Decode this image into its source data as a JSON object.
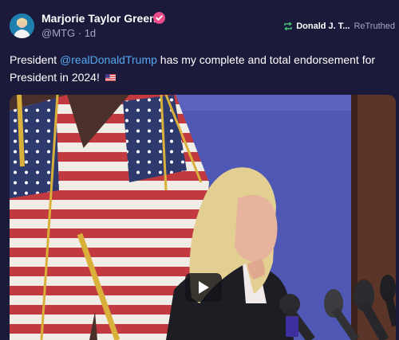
{
  "post": {
    "author": {
      "display_name": "Marjorie Taylor Greene",
      "handle": "@MTG",
      "separator": "·",
      "age": "1d",
      "verified_color": "#ea4c89"
    },
    "retruth": {
      "user": "Donald J. T...",
      "label": "ReTruthed",
      "icon": "retruth-icon",
      "icon_color": "#3fbf72"
    },
    "text": {
      "before": "President ",
      "mention": "@realDonaldTrump",
      "after": " has my complete and total endorsement for President in 2024!",
      "emoji": "us-flag-emoji"
    },
    "media": {
      "type": "video",
      "play_icon": "play-icon"
    }
  },
  "colors": {
    "background": "#1c1a3a",
    "mention": "#54a8f0",
    "muted": "#a7a5c8"
  }
}
